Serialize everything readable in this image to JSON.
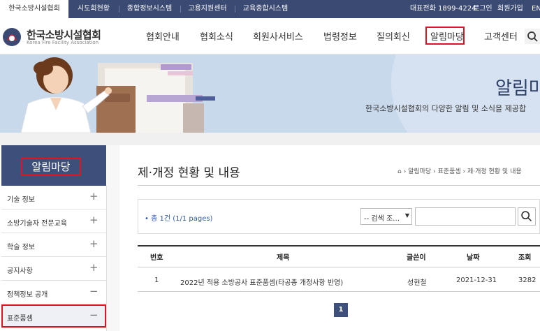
{
  "topbar": {
    "tabs": [
      "한국소방시설협회",
      "시도회현황",
      "종합정보시스템",
      "고용지원센터",
      "교육종합시스템"
    ],
    "phone": "대표전화 1899-4224",
    "login": "로그인",
    "signup": "회원가입",
    "lang": "EN"
  },
  "header": {
    "logo_ko": "한국소방시설협회",
    "logo_en": "Korea Fire Facility Association",
    "nav": [
      "협회안내",
      "협회소식",
      "회원사서비스",
      "법령정보",
      "질의회신",
      "알림마당",
      "고객센터"
    ]
  },
  "banner": {
    "title": "알림마",
    "subtitle": "한국소방시설협회의 다양한 알림 및 소식을 제공합"
  },
  "sidebar": {
    "title": "알림마당",
    "items": [
      {
        "label": "기술 정보",
        "sign": "+"
      },
      {
        "label": "소방기술자 전문교육",
        "sign": "+"
      },
      {
        "label": "학술 정보",
        "sign": "+"
      },
      {
        "label": "공지사항",
        "sign": "+"
      },
      {
        "label": "정책정보 공개",
        "sign": "−"
      },
      {
        "label": "표준품셈",
        "sign": "−"
      }
    ]
  },
  "main": {
    "title": "제·개정 현황 및 내용",
    "breadcrumb": "알림마당 › 표준품셈 › 제·개정 현황 및 내용",
    "total": "• 총 1건 (1/1 pages)",
    "select": "-- 검색 조…",
    "columns": [
      "번호",
      "제목",
      "글쓴이",
      "날짜",
      "조회"
    ],
    "rows": [
      {
        "no": "1",
        "title": "2022년 적용 소방공사 표준품셈(타공종 개정사항 반영)",
        "author": "성현철",
        "date": "2021-12-31",
        "views": "3282"
      }
    ],
    "page": "1"
  },
  "colors": {
    "navy": "#3b4a72",
    "highlight": "#e0141e",
    "banner_bg": "#c9d9ec"
  }
}
